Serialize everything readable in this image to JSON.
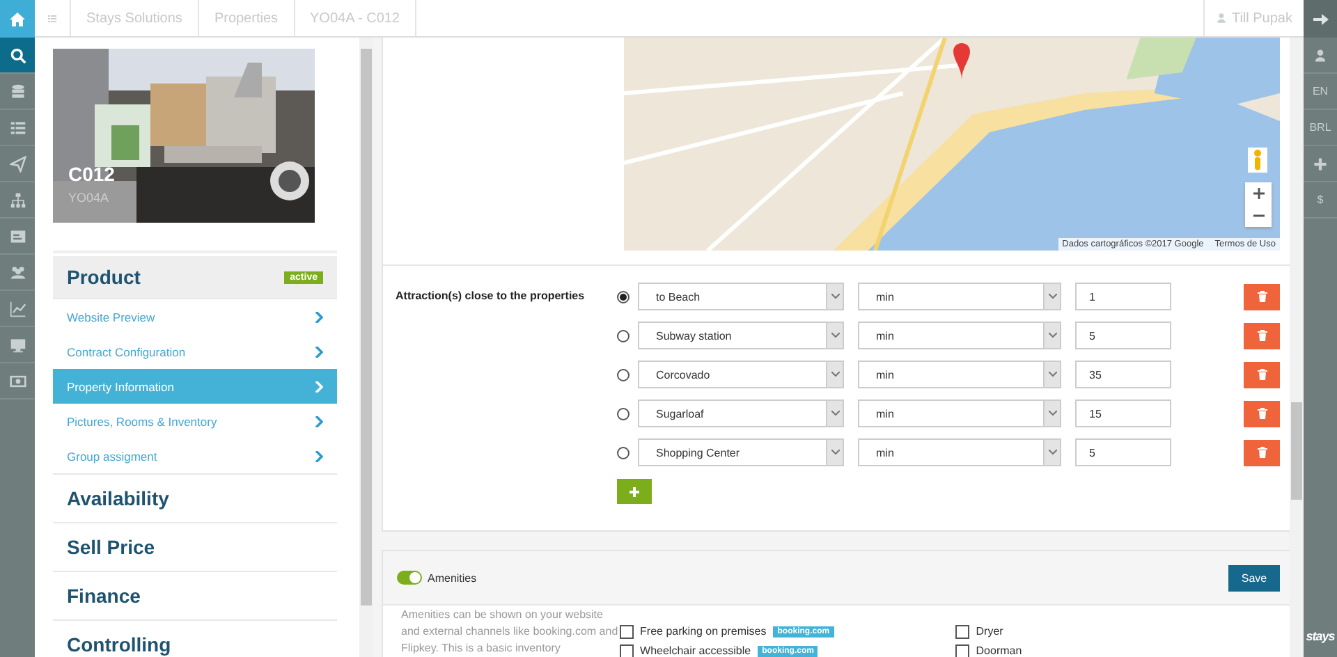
{
  "topbar": {
    "crumbs": [
      "Stays Solutions",
      "Properties",
      "YO04A - C012"
    ],
    "user": "Till Pupak"
  },
  "nav_icons": [
    {
      "kind": "search",
      "selected": true
    },
    {
      "kind": "database",
      "selected": false
    },
    {
      "kind": "list",
      "selected": false
    },
    {
      "kind": "send",
      "selected": false
    },
    {
      "kind": "sitemap",
      "selected": false
    },
    {
      "kind": "card",
      "selected": false
    },
    {
      "kind": "users",
      "selected": false
    },
    {
      "kind": "chart",
      "selected": false
    },
    {
      "kind": "monitor",
      "selected": false
    },
    {
      "kind": "money",
      "selected": false
    }
  ],
  "right_bar": [
    {
      "kind": "user"
    },
    {
      "kind": "text",
      "text": "EN"
    },
    {
      "kind": "text",
      "text": "BRL"
    },
    {
      "kind": "plus"
    },
    {
      "kind": "text",
      "text": "$"
    }
  ],
  "brand": "stays",
  "property": {
    "code": "C012",
    "group": "YO04A"
  },
  "menu": [
    {
      "title": "Product",
      "badge": "active",
      "expanded": true,
      "items": [
        {
          "label": "Website Preview",
          "selected": false
        },
        {
          "label": "Contract Configuration",
          "selected": false
        },
        {
          "label": "Property Information",
          "selected": true
        },
        {
          "label": "Pictures, Rooms & Inventory",
          "selected": false
        },
        {
          "label": "Group assigment",
          "selected": false
        }
      ]
    },
    {
      "title": "Availability",
      "expanded": false
    },
    {
      "title": "Sell Price",
      "expanded": false
    },
    {
      "title": "Finance",
      "expanded": false
    },
    {
      "title": "Controlling",
      "expanded": false
    }
  ],
  "map": {
    "attribution": "Dados cartográficos ©2017 Google",
    "terms": "Termos de Uso"
  },
  "attractions": {
    "label": "Attraction(s) close to the properties",
    "rows": [
      {
        "place": "to Beach",
        "unit": "min",
        "value": "1",
        "selected": true
      },
      {
        "place": "Subway station",
        "unit": "min",
        "value": "5",
        "selected": false
      },
      {
        "place": "Corcovado",
        "unit": "min",
        "value": "35",
        "selected": false
      },
      {
        "place": "Sugarloaf",
        "unit": "min",
        "value": "15",
        "selected": false
      },
      {
        "place": "Shopping Center",
        "unit": "min",
        "value": "5",
        "selected": false
      }
    ]
  },
  "amenities": {
    "label": "Amenities",
    "on": true,
    "save": "Save",
    "description": "Amenities can be shown on your website and external channels like booking.com and Flipkey. This is a basic inventory",
    "columns": [
      [
        {
          "label": "Free parking on premises",
          "checked": false,
          "badge": "booking.com"
        },
        {
          "label": "Wheelchair accessible",
          "checked": false,
          "badge": "booking.com"
        }
      ],
      [
        {
          "label": "Dryer",
          "checked": false
        },
        {
          "label": "Doorman",
          "checked": false
        }
      ]
    ]
  }
}
